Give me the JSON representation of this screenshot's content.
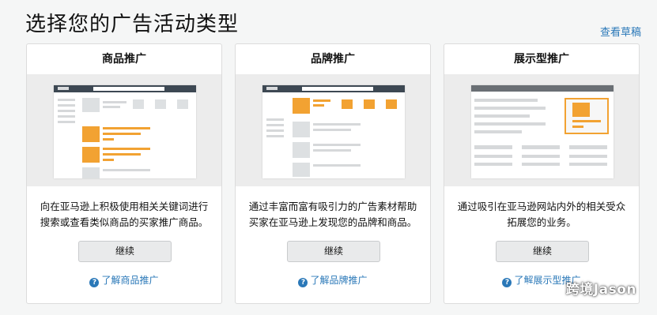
{
  "page": {
    "title": "选择您的广告活动类型",
    "drafts_link": "查看草稿"
  },
  "cards": [
    {
      "title": "商品推广",
      "desc_line1": "向在亚马逊上积极使用相关关键词进行",
      "desc_line2": "搜索或查看类似商品的买家推广商品。",
      "button": "继续",
      "learn": "了解商品推广"
    },
    {
      "title": "品牌推广",
      "desc_line1": "通过丰富而富有吸引力的广告素材帮助",
      "desc_line2": "买家在亚马逊上发现您的品牌和商品。",
      "button": "继续",
      "learn": "了解品牌推广"
    },
    {
      "title": "展示型推广",
      "desc_line1": "通过吸引在亚马逊网站内外的相关受众",
      "desc_line2": "拓展您的业务。",
      "button": "继续",
      "learn": "了解展示型推广"
    }
  ],
  "help_icon_glyph": "?",
  "watermark": "跨境Jason",
  "colors": {
    "accent": "#f2a232",
    "link": "#2a78b8",
    "topbar": "#3d4853"
  }
}
